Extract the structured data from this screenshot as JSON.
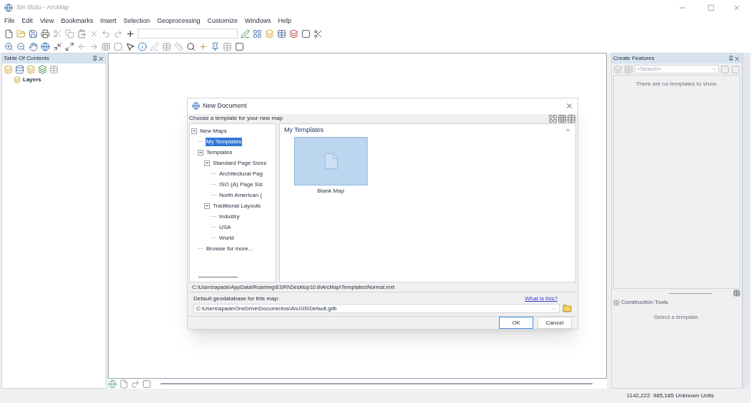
{
  "window": {
    "title": "Sin título - ArcMap"
  },
  "menu": [
    "File",
    "Edit",
    "View",
    "Bookmarks",
    "Insert",
    "Selection",
    "Geoprocessing",
    "Customize",
    "Windows",
    "Help"
  ],
  "toc": {
    "title": "Table Of Contents",
    "layers": "Layers"
  },
  "dialog": {
    "title": "New Document",
    "prompt": "Choose a template for your new map",
    "tree": [
      {
        "label": "New Maps",
        "expanded": true,
        "selected": false,
        "children": [
          {
            "label": "My Templates",
            "selected": true
          },
          {
            "label": "Templates",
            "expanded": true,
            "selected": false,
            "children": [
              {
                "label": "Standard Page Sizes",
                "expanded": true,
                "selected": false,
                "children": [
                  {
                    "label": "Architectural Pag",
                    "selected": false
                  },
                  {
                    "label": "ISO (A) Page Siz",
                    "selected": false
                  },
                  {
                    "label": "North American (",
                    "selected": false
                  }
                ]
              },
              {
                "label": "Traditional Layouts",
                "expanded": true,
                "selected": false,
                "children": [
                  {
                    "label": "Industry",
                    "selected": false
                  },
                  {
                    "label": "USA",
                    "selected": false
                  },
                  {
                    "label": "World",
                    "selected": false
                  }
                ]
              }
            ]
          },
          {
            "label": "Browse for more...",
            "selected": false
          }
        ]
      }
    ],
    "section_title": "My Templates",
    "templates": [
      {
        "label": "Blank Map",
        "selected": true
      }
    ],
    "path": "C:\\Users\\apade\\AppData\\Roaming\\ESRI\\Desktop10.8\\ArcMap\\Templates\\Normal.mxt",
    "gdb_label": "Default geodatabase for this map:",
    "gdb_link": "What is this?",
    "gdb_value": "C:\\Users\\apade\\OneDrive\\Documentos\\ArcGIS\\Default.gdb",
    "buttons": [
      "OK",
      "Cancel"
    ]
  },
  "create_features": {
    "title": "Create Features",
    "search_placeholder": "<Search>",
    "empty_message": "There are no templates to show."
  },
  "construction_tools": {
    "title": "Construction Tools",
    "message": "Select a template."
  },
  "status_bar": {
    "coordinates": "1142,222  985,185 Unknown Units"
  }
}
